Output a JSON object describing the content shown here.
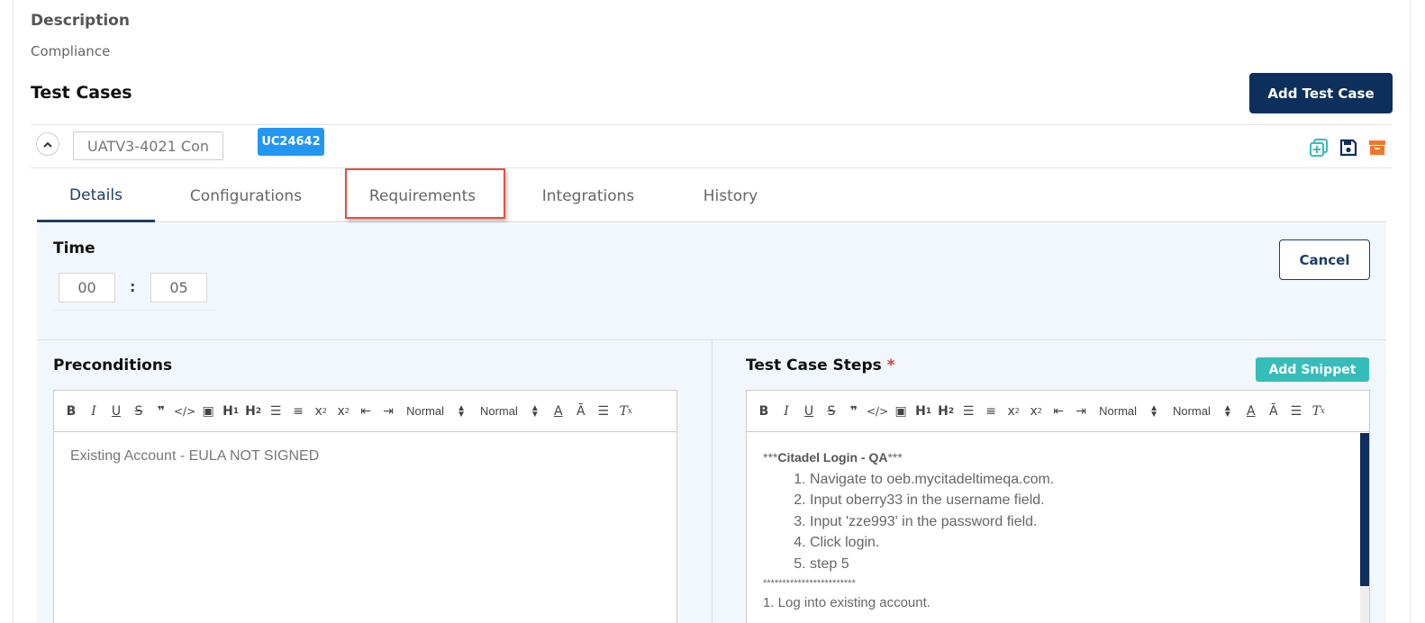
{
  "description": {
    "label": "Description",
    "value": "Compliance"
  },
  "test_cases": {
    "title": "Test Cases",
    "add_button": "Add Test Case"
  },
  "test_case": {
    "name": "UATV3-4021 Con",
    "id_badge": "UC24642",
    "badge_color": "#2196f3"
  },
  "tabs": [
    {
      "label": "Details",
      "active": true
    },
    {
      "label": "Configurations",
      "active": false
    },
    {
      "label": "Requirements",
      "active": false
    },
    {
      "label": "Integrations",
      "active": false
    },
    {
      "label": "History",
      "active": false
    }
  ],
  "details": {
    "time_label": "Time",
    "hours": "00",
    "separator": ":",
    "minutes": "05",
    "cancel_button": "Cancel",
    "preconditions_label": "Preconditions",
    "steps_label": "Test Case Steps",
    "required_mark": "*",
    "add_snippet_button": "Add Snippet",
    "preconditions_text": "Existing Account - EULA NOT SIGNED",
    "steps": {
      "header_prefix": "***",
      "header_bold": "Citadel Login - QA",
      "header_suffix": "***",
      "items": [
        "Navigate to oeb.mycitadeltimeqa.com.",
        "Input oberry33 in the username field.",
        "Input 'zze993' in the password field.",
        "Click login.",
        "step 5"
      ],
      "separator": "************************",
      "after": "1. Log into existing account."
    }
  },
  "toolbar": {
    "header_select": "Normal",
    "size_select": "Normal"
  },
  "colors": {
    "primary": "#0d2f5c",
    "snippet": "#36bdb9",
    "highlight": "#e0523d",
    "panel_bg": "#f1f7fc"
  }
}
